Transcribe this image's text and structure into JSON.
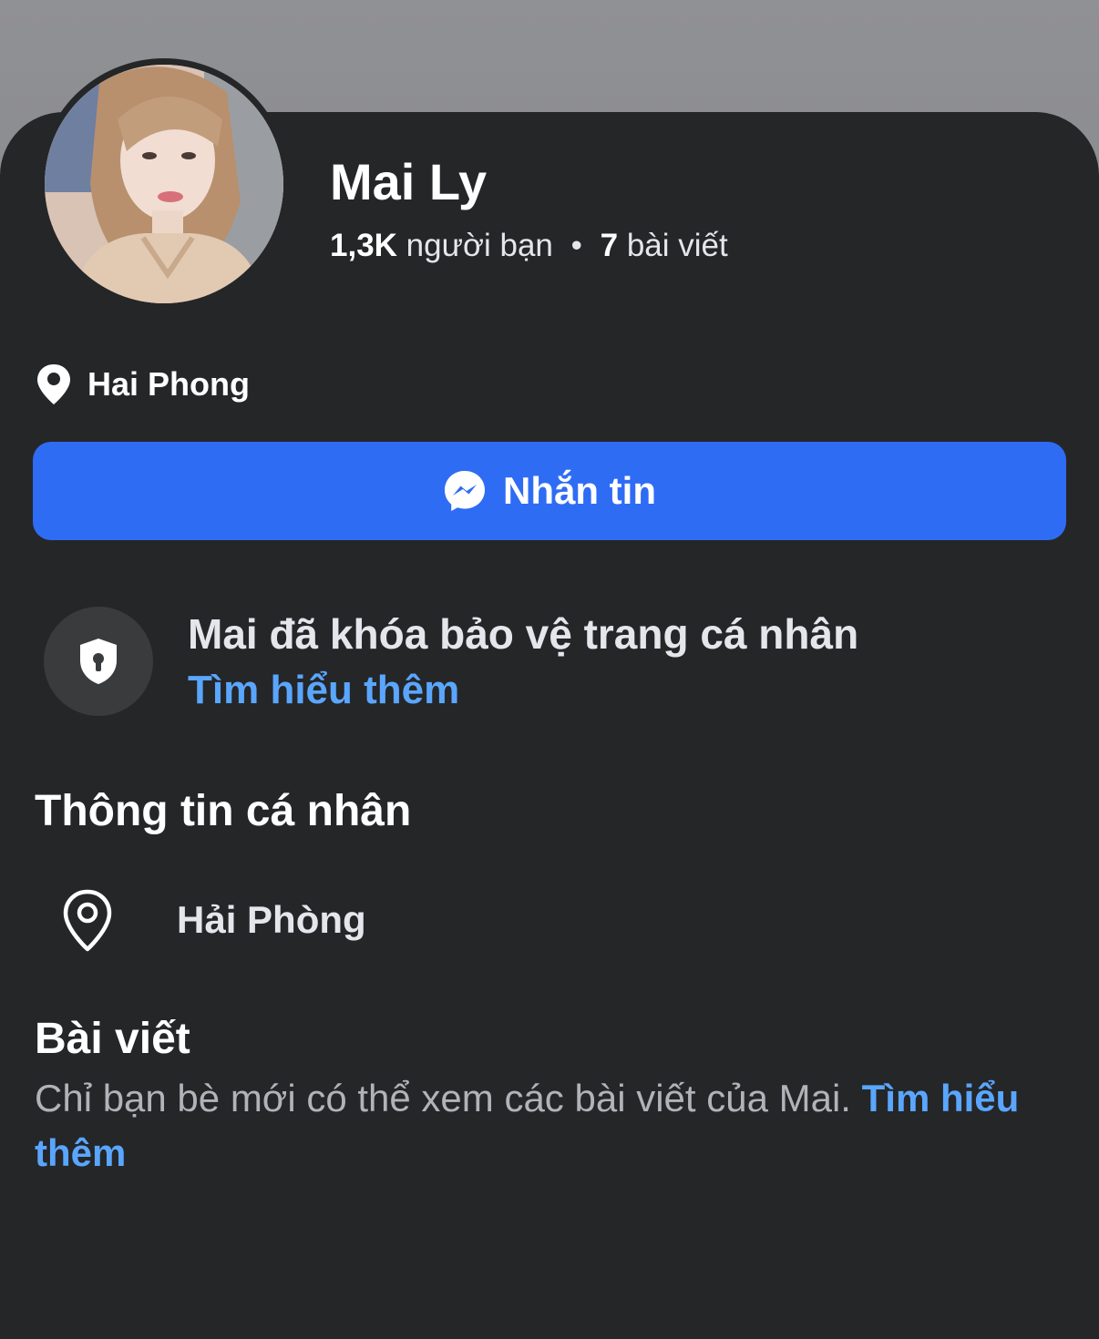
{
  "profile": {
    "name": "Mai Ly",
    "friends_count": "1,3K",
    "friends_label": "người bạn",
    "separator": "•",
    "posts_count": "7",
    "posts_label": "bài viết",
    "location": "Hai Phong"
  },
  "actions": {
    "message_label": "Nhắn tin",
    "message_icon": "messenger-icon"
  },
  "lock_notice": {
    "text": "Mai đã khóa bảo vệ trang cá nhân",
    "learn_more": "Tìm hiểu thêm",
    "icon": "shield-lock-icon"
  },
  "about": {
    "title": "Thông tin cá nhân",
    "location": "Hải Phòng",
    "icon": "location-pin-icon"
  },
  "posts": {
    "title": "Bài viết",
    "description": "Chỉ bạn bè mới có thể xem các bài viết của Mai.",
    "learn_more": "Tìm hiểu thêm"
  },
  "colors": {
    "background": "#252628",
    "primary_button": "#2f6cf4",
    "link": "#5aa6ff",
    "secondary_text": "#b0b3b8"
  }
}
